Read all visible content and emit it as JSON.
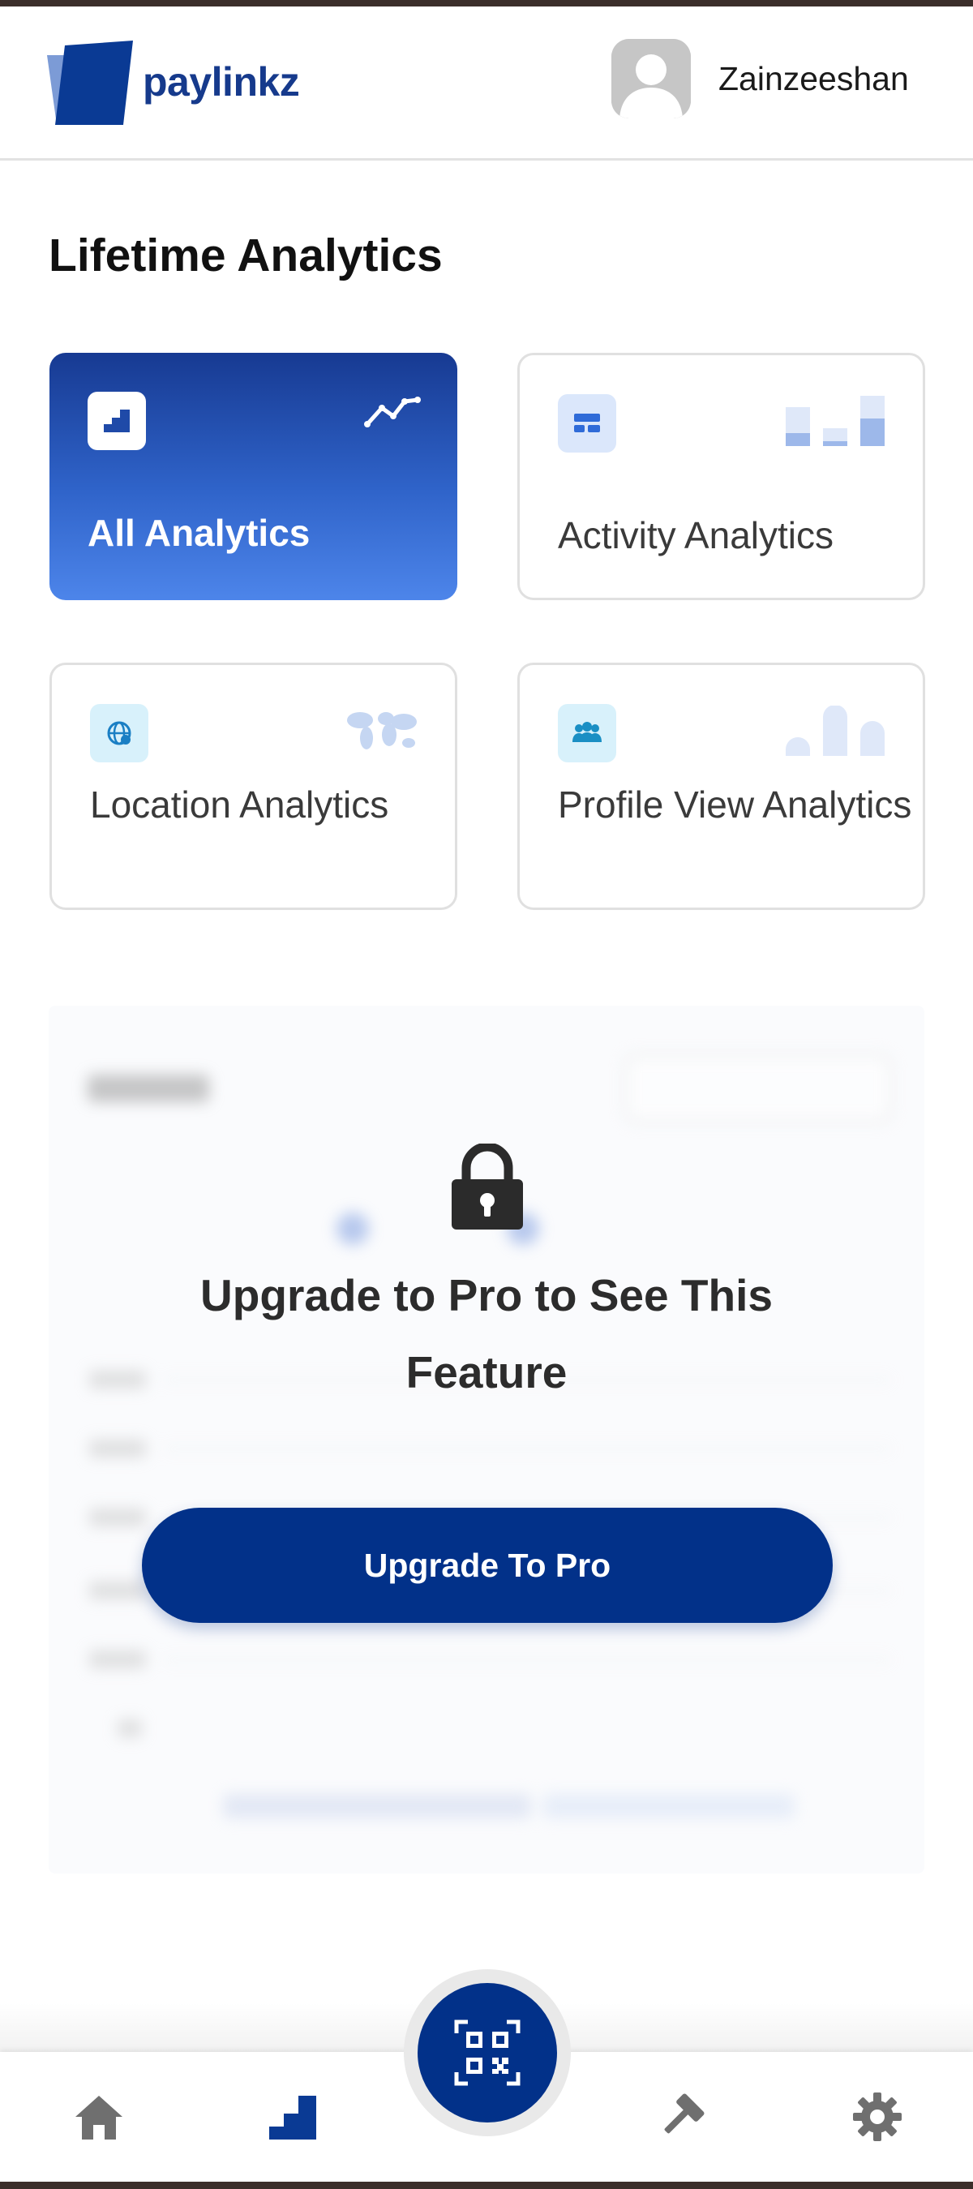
{
  "app": {
    "brand": "paylinkz"
  },
  "header": {
    "username": "Zainzeeshan",
    "avatar_icon": "user-avatar-icon"
  },
  "page": {
    "title": "Lifetime Analytics"
  },
  "cards": [
    {
      "label": "All Analytics",
      "icon": "analytics-steps-icon",
      "active": true
    },
    {
      "label": "Activity Analytics",
      "icon": "activity-card-icon",
      "active": false
    },
    {
      "label": "Location Analytics",
      "icon": "globe-icon",
      "active": false
    },
    {
      "label": "Profile View Analytics",
      "icon": "people-icon",
      "active": false
    }
  ],
  "locked": {
    "message": "Upgrade to Pro to See This Feature",
    "button_label": "Upgrade To Pro"
  },
  "nav": [
    {
      "name": "home",
      "icon": "home-icon",
      "active": false
    },
    {
      "name": "analytics",
      "icon": "analytics-icon",
      "active": true
    },
    {
      "name": "qr",
      "icon": "qr-code-icon",
      "active": false
    },
    {
      "name": "tools",
      "icon": "hammer-icon",
      "active": false
    },
    {
      "name": "settings",
      "icon": "gear-icon",
      "active": false
    }
  ],
  "colors": {
    "primary": "#023189",
    "brand_text": "#163a8c",
    "active_card_start": "#173a92",
    "active_card_end": "#4d85ea",
    "icon_tint_bg": "#dbe7fb",
    "icon_tint_cyan": "#d8f1fb",
    "nav_inactive": "#6f6f6f"
  }
}
